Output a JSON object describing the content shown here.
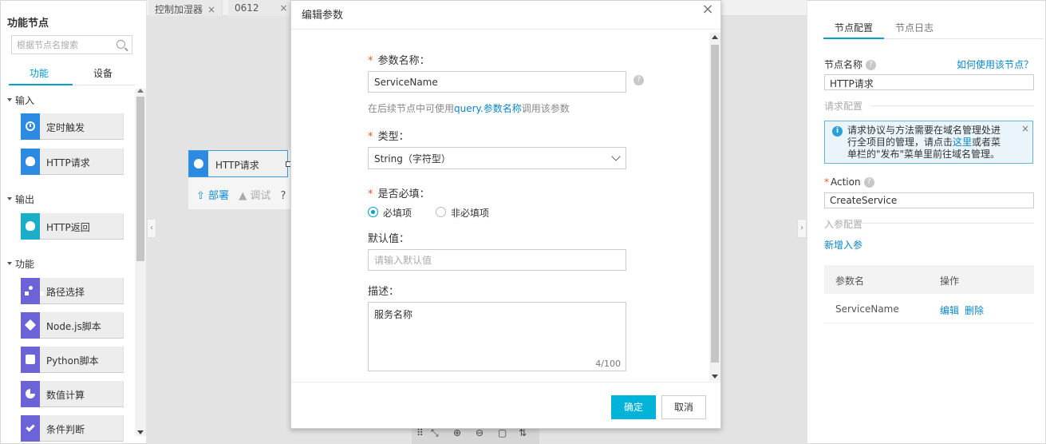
{
  "left_panel": {
    "title": "功能节点",
    "search_placeholder": "根据节点名搜索",
    "tabs": [
      "功能",
      "设备"
    ],
    "groups": [
      {
        "title": "输入",
        "items": [
          {
            "label": "定时触发",
            "icon": "clock-icon"
          },
          {
            "label": "HTTP请求",
            "icon": "http-request-icon"
          }
        ]
      },
      {
        "title": "输出",
        "items": [
          {
            "label": "HTTP返回",
            "icon": "bulb-icon"
          }
        ]
      },
      {
        "title": "功能",
        "items": [
          {
            "label": "路径选择",
            "icon": "route-icon"
          },
          {
            "label": "Node.js脚本",
            "icon": "nodejs-icon"
          },
          {
            "label": "Python脚本",
            "icon": "puzzle-icon"
          },
          {
            "label": "数值计算",
            "icon": "pie-icon"
          },
          {
            "label": "条件判断",
            "icon": "check-icon"
          }
        ]
      }
    ]
  },
  "canvas": {
    "tabs": [
      {
        "label": "控制加湿器",
        "close": "×"
      },
      {
        "label": "0612",
        "close": "×"
      }
    ],
    "node": {
      "label": "HTTP请求"
    },
    "node_actions": {
      "deploy": "部署",
      "debug": "调试",
      "help": "?"
    },
    "zoom_tools": [
      "⠿",
      "⤡",
      "⊕",
      "⊖",
      "▢",
      "⇅"
    ]
  },
  "right_panel": {
    "tabs": [
      "节点配置",
      "节点日志"
    ],
    "node_name_label": "节点名称",
    "how_to_link": "如何使用该节点？",
    "node_name_value": "HTTP请求",
    "request_config_label": "请求配置",
    "info": {
      "text_1": "请求协议与方法需要在域名管理处进行全项目的管理，请点击",
      "link": "这里",
      "text_2": "或者菜单栏的\"发布\"菜单里前往域名管理。",
      "close": "×"
    },
    "action_label": "Action",
    "action_value": "CreateService",
    "input_params_label": "入参配置",
    "add_param_link": "新增入参",
    "table": {
      "headers": [
        "参数名",
        "操作"
      ],
      "rows": [
        {
          "name": "ServiceName",
          "edit": "编辑",
          "delete": "删除"
        }
      ]
    }
  },
  "modal": {
    "title": "编辑参数",
    "close": "×",
    "param_name_label": "参数名称：",
    "param_name_value": "ServiceName",
    "help_prefix": "在后续节点中可使用",
    "help_link": "query.参数名称",
    "help_suffix": "调用该参数",
    "type_label": "类型：",
    "type_value": "String（字符型）",
    "required_label": "是否必填：",
    "required_options": [
      "必填项",
      "非必填项"
    ],
    "required_selected": "必填项",
    "default_label": "默认值：",
    "default_placeholder": "请输入默认值",
    "desc_label": "描述：",
    "desc_value": "服务名称",
    "desc_count": "4/100",
    "ok": "确定",
    "cancel": "取消"
  },
  "colors": {
    "accent": "#00a2ca",
    "link": "#0a86c4",
    "node_blue": "#2c8be0",
    "node_purple": "#6c63d6",
    "node_teal": "#1aaec8",
    "required": "#e25a22"
  }
}
